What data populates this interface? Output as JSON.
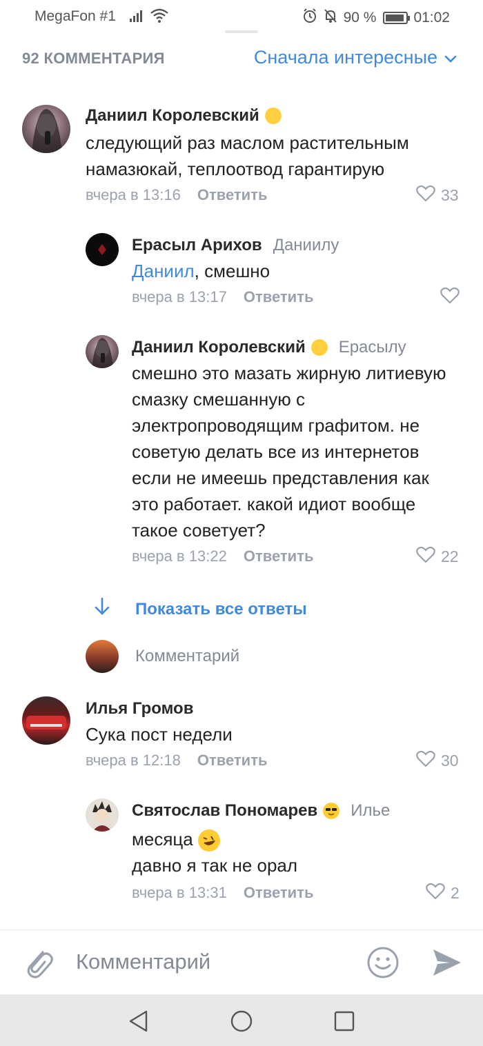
{
  "status_bar": {
    "carrier": "MegaFon #1",
    "battery": "90 %",
    "time": "01:02"
  },
  "header": {
    "count": "92 КОММЕНТАРИЯ",
    "sort": "Сначала интересные"
  },
  "comments": [
    {
      "author": "Даниил Королевский",
      "text": "следующий раз маслом растительным намазюкай, теплоотвод гарантирую",
      "time": "вчера в 13:16",
      "reply": "Ответить",
      "likes": "33"
    },
    {
      "author": "Ерасыл Арихов",
      "reply_to": "Даниилу",
      "mention": "Даниил",
      "text": ", смешно",
      "time": "вчера в 13:17",
      "reply": "Ответить"
    },
    {
      "author": "Даниил Королевский",
      "reply_to": "Ерасылу",
      "text": "смешно это мазать жирную литиевую смазку смешанную с электропроводящим графитом. не советую делать все из интернетов если не имеешь представления как это работает. какой идиот вообще такое советует?",
      "time": "вчера в 13:22",
      "reply": "Ответить",
      "likes": "22"
    },
    {
      "author": "Илья Громов",
      "text": "Сука пост недели",
      "time": "вчера в 12:18",
      "reply": "Ответить",
      "likes": "30"
    },
    {
      "author": "Святослав Пономарев",
      "reply_to": "Илье",
      "text_line1": "месяца",
      "text_line2": "давно я так не орал",
      "time": "вчера в 13:31",
      "reply": "Ответить",
      "likes": "2"
    }
  ],
  "show_all": "Показать все ответы",
  "comment_placeholder": "Комментарий",
  "input": {
    "placeholder": "Комментарий"
  },
  "colors": {
    "accent": "#3f8ae0",
    "secondary": "#99a2ad",
    "text": "#222222"
  }
}
